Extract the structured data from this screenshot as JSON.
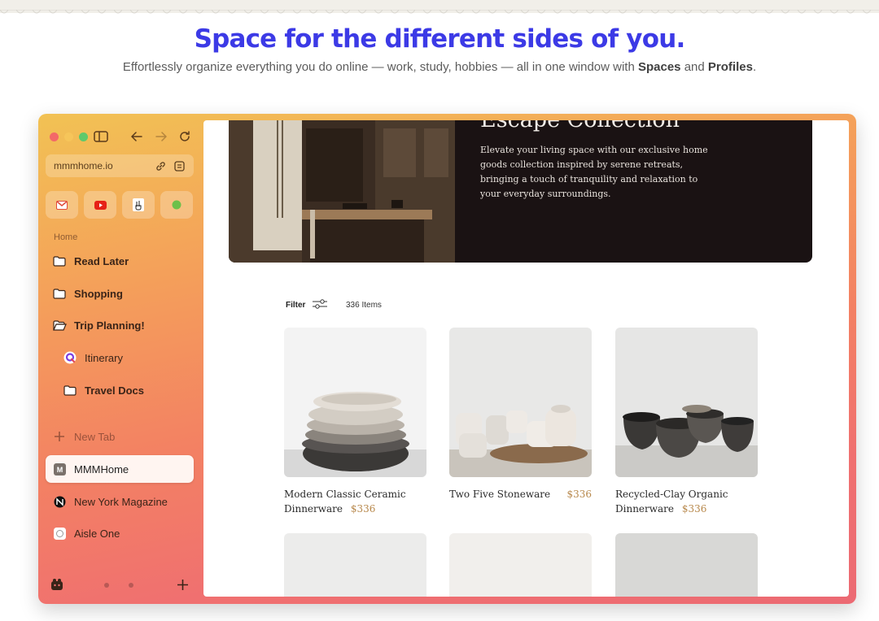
{
  "hero_banner": {
    "headline": "Space for the different sides of you.",
    "subline_pre": "Effortlessly organize everything you do online — work, study, hobbies — all in one window with ",
    "subline_spaces": "Spaces",
    "subline_and": " and ",
    "subline_profiles": "Profiles",
    "subline_end": "."
  },
  "browser": {
    "url": "mmmhome.io",
    "favorites": [
      {
        "name": "gmail",
        "icon": "gmail-icon"
      },
      {
        "name": "youtube",
        "icon": "youtube-icon"
      },
      {
        "name": "peace",
        "icon": "peace-hand-icon"
      },
      {
        "name": "green",
        "icon": "green-dot-icon"
      }
    ],
    "space_label": "Home",
    "items": [
      {
        "label": "Read Later",
        "icon": "folder-icon"
      },
      {
        "label": "Shopping",
        "icon": "folder-icon"
      },
      {
        "label": "Trip Planning!",
        "icon": "folder-open-icon"
      },
      {
        "label": "Itinerary",
        "icon": "q-app-icon"
      },
      {
        "label": "Travel Docs",
        "icon": "folder-icon"
      }
    ],
    "new_tab_label": "New Tab",
    "tabs": [
      {
        "label": "MMMHome",
        "icon": "m-badge-icon"
      },
      {
        "label": "New York Magazine",
        "icon": "nymag-icon"
      },
      {
        "label": "Aisle One",
        "icon": "aisle-one-icon"
      }
    ]
  },
  "page": {
    "hero_title": "Escape Collection",
    "hero_desc": "Elevate your living space with our exclusive home goods collection inspired by serene retreats, bringing a touch of tranquility and relaxation to your everyday surroundings.",
    "filter_label": "Filter",
    "items_count": "336 Items",
    "products": [
      {
        "name": "Modern Classic Ceramic Dinnerware",
        "price": "$336"
      },
      {
        "name": "Two Five Stoneware",
        "price": "$336"
      },
      {
        "name": "Recycled-Clay Organic Dinnerware",
        "price": "$336"
      }
    ]
  },
  "colors": {
    "headline": "#3c3ae6",
    "accent_price": "#b8894d"
  }
}
